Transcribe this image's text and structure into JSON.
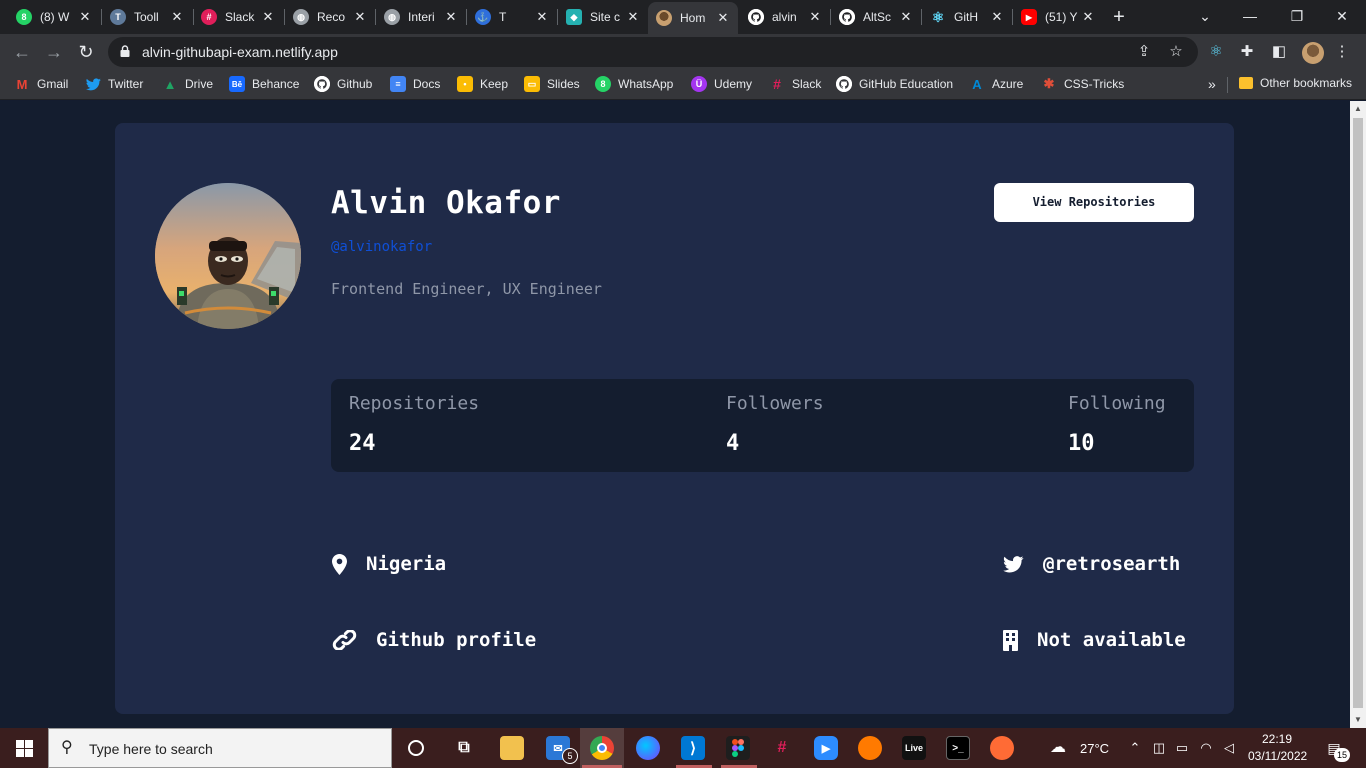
{
  "browser": {
    "tabs": [
      {
        "title": "(8) W",
        "favicon": "whatsapp-icon",
        "color": "#25d366",
        "glyph": "8"
      },
      {
        "title": "Tooll",
        "favicon": "tool-icon",
        "color": "#5f7a9a",
        "glyph": "T"
      },
      {
        "title": "Slack",
        "favicon": "slack-icon",
        "color": "#e01e5a",
        "glyph": "#"
      },
      {
        "title": "Reco",
        "favicon": "globe-icon",
        "color": "#9aa0a6",
        "glyph": "◍"
      },
      {
        "title": "Interi",
        "favicon": "globe-icon",
        "color": "#9aa0a6",
        "glyph": "◍"
      },
      {
        "title": "T",
        "favicon": "anchor-icon",
        "color": "#2f6fdb",
        "glyph": "⚓"
      },
      {
        "title": "Site c",
        "favicon": "netlify-icon",
        "color": "#25b1b1",
        "glyph": "◆"
      },
      {
        "title": "Hom",
        "favicon": "avatar-icon",
        "color": "#c8a070",
        "glyph": ""
      },
      {
        "title": "alvin",
        "favicon": "github-icon",
        "color": "#ffffff",
        "glyph": ""
      },
      {
        "title": "AltSc",
        "favicon": "github-icon",
        "color": "#ffffff",
        "glyph": ""
      },
      {
        "title": "GitH",
        "favicon": "react-icon",
        "color": "#61dafb",
        "glyph": "⚛"
      },
      {
        "title": "(51) Y",
        "favicon": "youtube-icon",
        "color": "#ff0000",
        "glyph": "▶"
      }
    ],
    "url": "alvin-githubapi-exam.netlify.app",
    "bookmarks": [
      {
        "label": "Gmail",
        "icon": "gmail-icon",
        "color": "#ea4335",
        "glyph": "M"
      },
      {
        "label": "Twitter",
        "icon": "twitter-icon",
        "color": "#1d9bf0",
        "glyph": "t"
      },
      {
        "label": "Drive",
        "icon": "drive-icon",
        "color": "#1fa463",
        "glyph": "▲"
      },
      {
        "label": "Behance",
        "icon": "behance-icon",
        "color": "#1769ff",
        "glyph": "Bē"
      },
      {
        "label": "Github",
        "icon": "github-icon",
        "color": "#ffffff",
        "glyph": ""
      },
      {
        "label": "Docs",
        "icon": "docs-icon",
        "color": "#4285f4",
        "glyph": "≡"
      },
      {
        "label": "Keep",
        "icon": "keep-icon",
        "color": "#fbbc04",
        "glyph": "•"
      },
      {
        "label": "Slides",
        "icon": "slides-icon",
        "color": "#fbbc04",
        "glyph": "▭"
      },
      {
        "label": "WhatsApp",
        "icon": "whatsapp-icon",
        "color": "#25d366",
        "glyph": "8"
      },
      {
        "label": "Udemy",
        "icon": "udemy-icon",
        "color": "#a435f0",
        "glyph": "Ü"
      },
      {
        "label": "Slack",
        "icon": "slack-icon",
        "color": "#e01e5a",
        "glyph": "#"
      },
      {
        "label": "GitHub Education",
        "icon": "github-icon",
        "color": "#ffffff",
        "glyph": ""
      },
      {
        "label": "Azure",
        "icon": "azure-icon",
        "color": "#0089d6",
        "glyph": "A"
      },
      {
        "label": "CSS-Tricks",
        "icon": "css-tricks-icon",
        "color": "#e04e39",
        "glyph": "✱"
      }
    ],
    "overflow_label": "»",
    "other_bookmarks": "Other bookmarks"
  },
  "profile": {
    "name": "Alvin Okafor",
    "handle": "@alvinokafor",
    "bio": "Frontend Engineer, UX Engineer",
    "view_button": "View Repositories",
    "stats": [
      {
        "label": "Repositories",
        "value": "24"
      },
      {
        "label": "Followers",
        "value": "4"
      },
      {
        "label": "Following",
        "value": "10"
      }
    ],
    "location": "Nigeria",
    "twitter": "@retrosearth",
    "website": "Github profile",
    "company": "Not available"
  },
  "taskbar": {
    "search_placeholder": "Type here to search",
    "mail_badge": "5",
    "live_label": "Live",
    "weather": "27°C",
    "time": "22:19",
    "date": "03/11/2022",
    "notification_count": "15"
  },
  "colors": {
    "page_bg": "#141d2f",
    "card_bg": "#1f2a48",
    "accent_link": "#0f4fd6",
    "muted_text": "#8f97a8"
  }
}
